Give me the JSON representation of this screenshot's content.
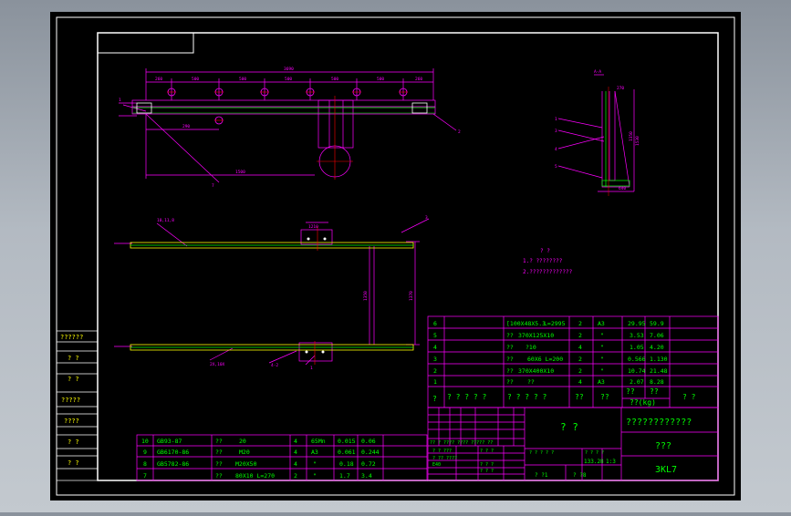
{
  "viewport": {
    "background_top": "#8a929c",
    "background_bottom": "#c3c9cf",
    "sheet_color": "#000000",
    "frame_color": "#ffffff"
  },
  "colors": {
    "magenta": "#ff00ff",
    "green": "#00ff00",
    "white": "#ffffff",
    "red": "#ff0000",
    "yellow": "#ffff00"
  },
  "top_view": {
    "dim_overall": "3690",
    "dim_segments": [
      "260",
      "500",
      "500",
      "500",
      "500",
      "500",
      "260"
    ],
    "dim_lower": "290",
    "dim_bottom": "1500",
    "leaders": [
      "1",
      "2",
      "7"
    ]
  },
  "side_view": {
    "leader_top_left": "10,11,8",
    "leader_top_right": "3",
    "dim_height": "1350",
    "dim_height_2": "1370",
    "dim_top": "1210",
    "leader_bottom_left": "2X,10X",
    "leader_bottom_mid": "4-2",
    "leader_bottom_center": "1"
  },
  "section_view": {
    "label": "A-A",
    "leaders": [
      "1",
      "3",
      "4",
      "5"
    ],
    "dims": [
      "270",
      "1350",
      "1530",
      "640"
    ]
  },
  "notes": {
    "title": "? ?",
    "line1": "1.? ????????",
    "line2": "2.?????????????"
  },
  "parts_list": {
    "rows": [
      {
        "no": "6",
        "name": "[100X48X5.3",
        "spec": "L=2995",
        "qty": "2",
        "mat": "A3",
        "w1": "29.95",
        "w2": "59.9"
      },
      {
        "no": "5",
        "name": "??",
        "spec": "370X125X10",
        "qty": "2",
        "mat": "\"",
        "w1": "3.53",
        "w2": "7.06"
      },
      {
        "no": "4",
        "name": "??",
        "spec": "?10",
        "qty": "4",
        "mat": "\"",
        "w1": "1.05",
        "w2": "4.20"
      },
      {
        "no": "3",
        "name": "??",
        "spec": "60X6 L=200",
        "qty": "2",
        "mat": "\"",
        "w1": "0.566",
        "w2": "1.130"
      },
      {
        "no": "2",
        "name": "??",
        "spec": "370X400X10",
        "qty": "2",
        "mat": "\"",
        "w1": "10.74",
        "w2": "21.48"
      },
      {
        "no": "1",
        "name": "??",
        "spec": "??",
        "qty": "4",
        "mat": "A3",
        "w1": "2.07",
        "w2": "8.28"
      }
    ],
    "header": {
      "no": "?",
      "name": "? ? ? ? ?",
      "spec": "? ? ? ? ?",
      "qty": "??",
      "mat": "??",
      "w1": "??",
      "w2": "??",
      "wunit": "??(kg)",
      "note": "? ?"
    }
  },
  "std_parts": {
    "rows": [
      {
        "no": "10",
        "code": "GB93-87",
        "name": "??",
        "spec": "20",
        "qty": "4",
        "mat": "65Mn",
        "w1": "0.015",
        "w2": "0.06"
      },
      {
        "no": "9",
        "code": "GB6170-86",
        "name": "??",
        "spec": "M20",
        "qty": "4",
        "mat": "A3",
        "w1": "0.061",
        "w2": "0.244"
      },
      {
        "no": "8",
        "code": "GB5782-86",
        "name": "??",
        "spec": "M20X50",
        "qty": "4",
        "mat": "\"",
        "w1": "0.18",
        "w2": "0.72"
      },
      {
        "no": "7",
        "code": "",
        "name": "??",
        "spec": "80X10 L=270",
        "qty": "2",
        "mat": "\"",
        "w1": "1.7",
        "w2": "3.4"
      }
    ]
  },
  "title_block": {
    "center": "? ?",
    "drawing_name": "????????????",
    "company": "???",
    "drawing_code": "3KL7",
    "row_a": "?? ? ???? ???? ????? ??",
    "row_b": "? ? ???",
    "row_c": "? ?? ????",
    "weight": "133.28",
    "scale": "1:3",
    "sheet": "? ?1",
    "sheets": "? ?8",
    "mini_labels": [
      "? ? ? ? ?",
      "? ? ? ?",
      "? ? ?",
      "E40",
      "? ? ?",
      "? ? ?"
    ]
  },
  "left_margin": {
    "labels": [
      "??????",
      "? ?",
      "? ?",
      "?????",
      "????",
      "? ?",
      "? ?"
    ]
  }
}
